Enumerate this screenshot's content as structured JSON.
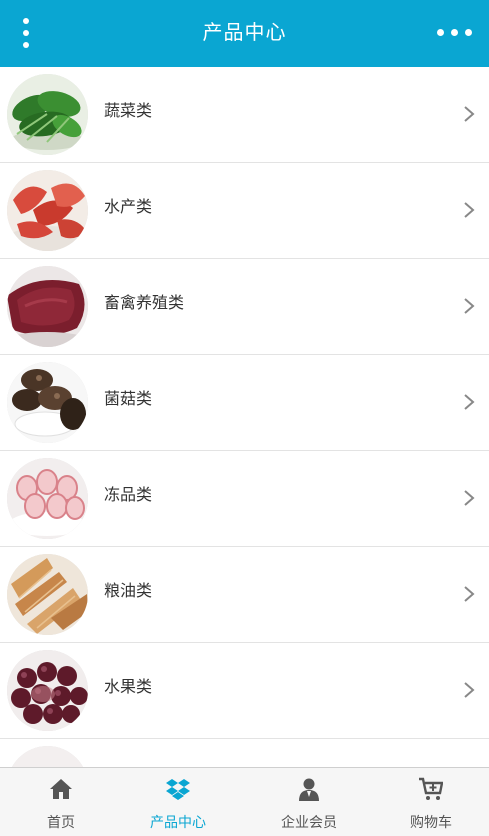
{
  "header": {
    "title": "产品中心"
  },
  "categories": [
    {
      "label": "蔬菜类",
      "icon": "spinach-thumbnail"
    },
    {
      "label": "水产类",
      "icon": "shrimp-thumbnail"
    },
    {
      "label": "畜禽养殖类",
      "icon": "meat-thumbnail"
    },
    {
      "label": "菌菇类",
      "icon": "mushroom-thumbnail"
    },
    {
      "label": "冻品类",
      "icon": "frozen-meat-roll-thumbnail"
    },
    {
      "label": "粮油类",
      "icon": "dried-fish-thumbnail"
    },
    {
      "label": "水果类",
      "icon": "grapes-thumbnail"
    }
  ],
  "tabbar": {
    "home": {
      "label": "首页",
      "icon": "home-icon"
    },
    "products": {
      "label": "产品中心",
      "icon": "dropbox-icon",
      "active": true
    },
    "members": {
      "label": "企业会员",
      "icon": "member-icon"
    },
    "cart": {
      "label": "购物车",
      "icon": "cart-icon"
    }
  },
  "colors": {
    "accent": "#0aa6d2",
    "text": "#333333",
    "divider": "#e3e3e3",
    "tab_text": "#555555"
  }
}
